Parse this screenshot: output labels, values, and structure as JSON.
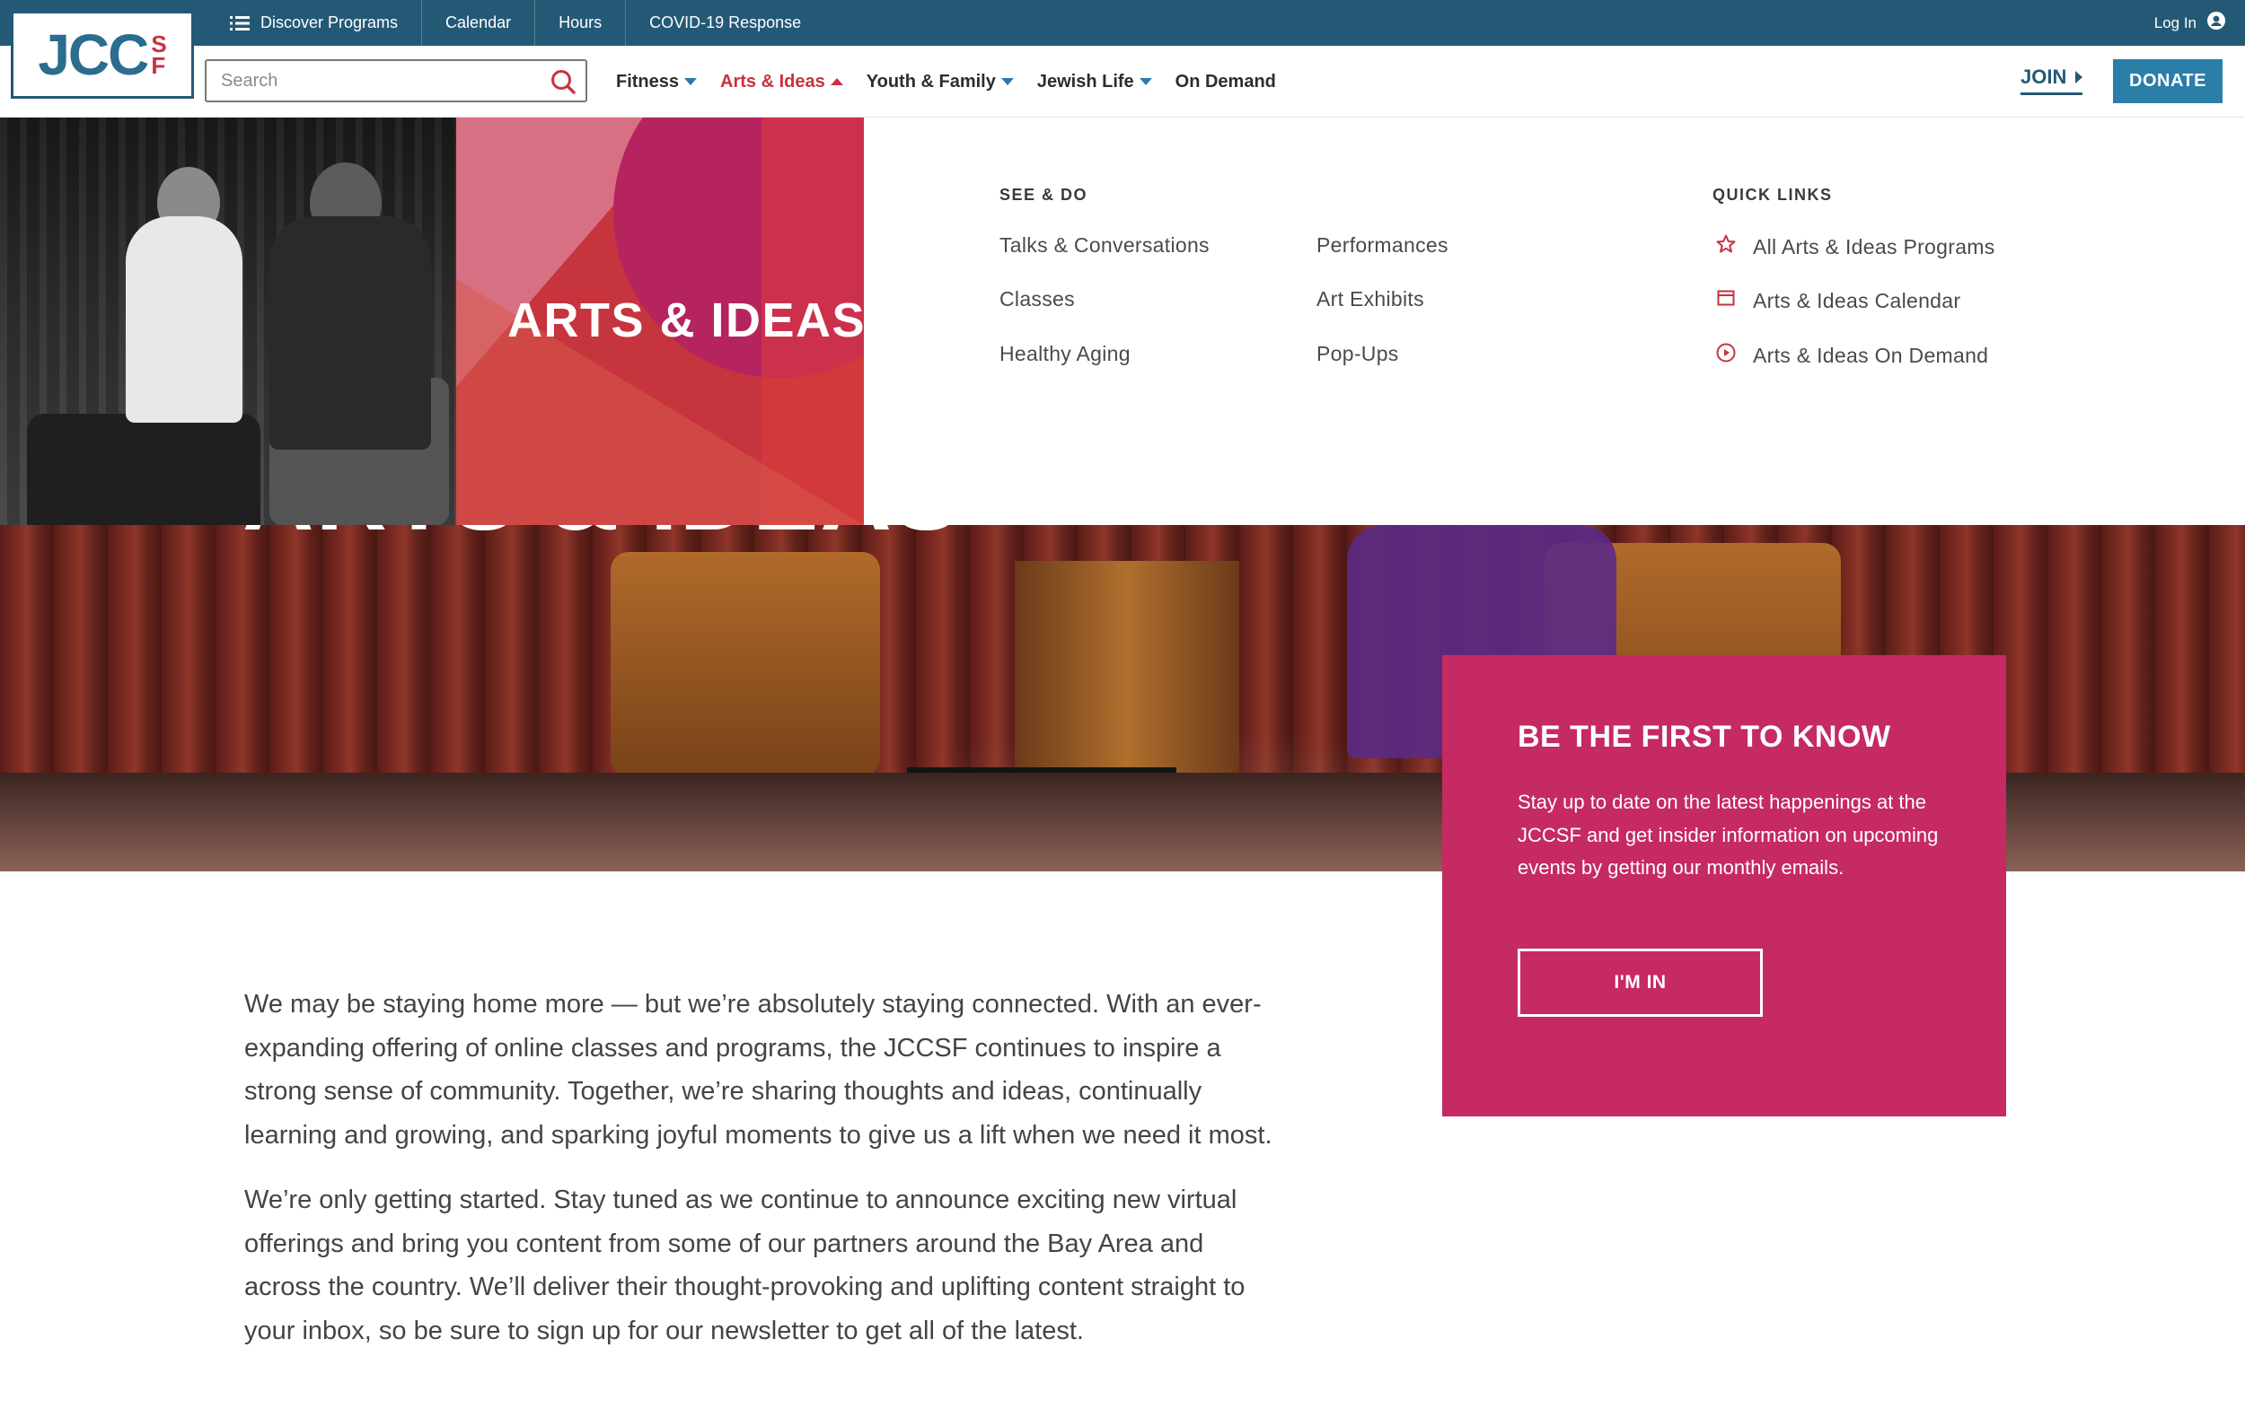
{
  "topbar": {
    "links": [
      {
        "label": "Discover Programs",
        "icon": "list-icon"
      },
      {
        "label": "Calendar"
      },
      {
        "label": "Hours"
      },
      {
        "label": "COVID-19 Response"
      }
    ],
    "login_label": "Log In",
    "login_icon": "user-circle-icon",
    "bg_color": "#245976"
  },
  "logo": {
    "main": "JCC",
    "sub1": "S",
    "sub2": "F"
  },
  "search": {
    "placeholder": "Search",
    "value": "",
    "icon": "search-icon"
  },
  "nav": {
    "items": [
      {
        "label": "Fitness",
        "has_caret": true,
        "active": false
      },
      {
        "label": "Arts & Ideas",
        "has_caret": true,
        "active": true
      },
      {
        "label": "Youth & Family",
        "has_caret": true,
        "active": false
      },
      {
        "label": "Jewish Life",
        "has_caret": true,
        "active": false
      },
      {
        "label": "On Demand",
        "has_caret": false,
        "active": false
      }
    ],
    "join_label": "JOIN",
    "donate_label": "DONATE",
    "accent_color": "#c7323f",
    "donate_color": "#2a7ea8"
  },
  "dropdown": {
    "feature_title": "ARTS & IDEAS",
    "see_do_heading": "SEE & DO",
    "see_do_col1": [
      "Talks & Conversations",
      "Classes",
      "Healthy Aging"
    ],
    "see_do_col2": [
      "Performances",
      "Art Exhibits",
      "Pop-Ups"
    ],
    "quick_links_heading": "QUICK LINKS",
    "quick_links": [
      {
        "label": "All Arts & Ideas Programs",
        "icon": "star-icon"
      },
      {
        "label": "Arts & Ideas Calendar",
        "icon": "calendar-icon"
      },
      {
        "label": "Arts & Ideas On Demand",
        "icon": "play-circle-icon"
      }
    ]
  },
  "hero": {
    "title": "ARTS & IDEAS"
  },
  "newsletter": {
    "heading": "BE THE FIRST TO KNOW",
    "text": "Stay up to date on the latest happenings at the JCCSF and get insider information on upcoming events by getting our monthly emails.",
    "button_label": "I'M IN",
    "bg_color": "#c52a63"
  },
  "body": {
    "paragraphs": [
      "We may be staying home more — but we’re absolutely staying connected. With an ever-expanding offering of online classes and programs, the JCCSF continues to inspire a strong sense of community. Together, we’re sharing thoughts and ideas, continually learning and growing, and sparking joyful moments to give us a lift when we need it most.",
      "We’re only getting started. Stay tuned as we continue to announce exciting new virtual offerings and bring you content from some of our partners around the Bay Area and across the country. We’ll deliver their thought-provoking and uplifting content straight to your inbox, so be sure to sign up for our newsletter to get all of the latest."
    ]
  }
}
